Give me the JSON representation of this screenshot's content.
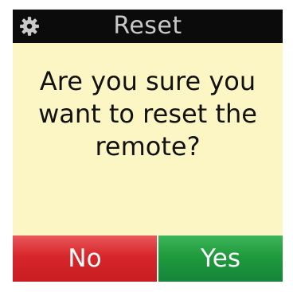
{
  "title_bar": {
    "icon": "gear-icon",
    "title": "Reset"
  },
  "dialog": {
    "message_lines": [
      "Are you sure you",
      "want to reset the",
      "remote?"
    ]
  },
  "buttons": {
    "no_label": "No",
    "yes_label": "Yes"
  },
  "colors": {
    "title_bar_bg": "#0b0b0b",
    "title_text": "#c9c9c9",
    "body_bg": "#fbf6c4",
    "no_button": "#d6262b",
    "yes_button": "#1f9a3d"
  }
}
